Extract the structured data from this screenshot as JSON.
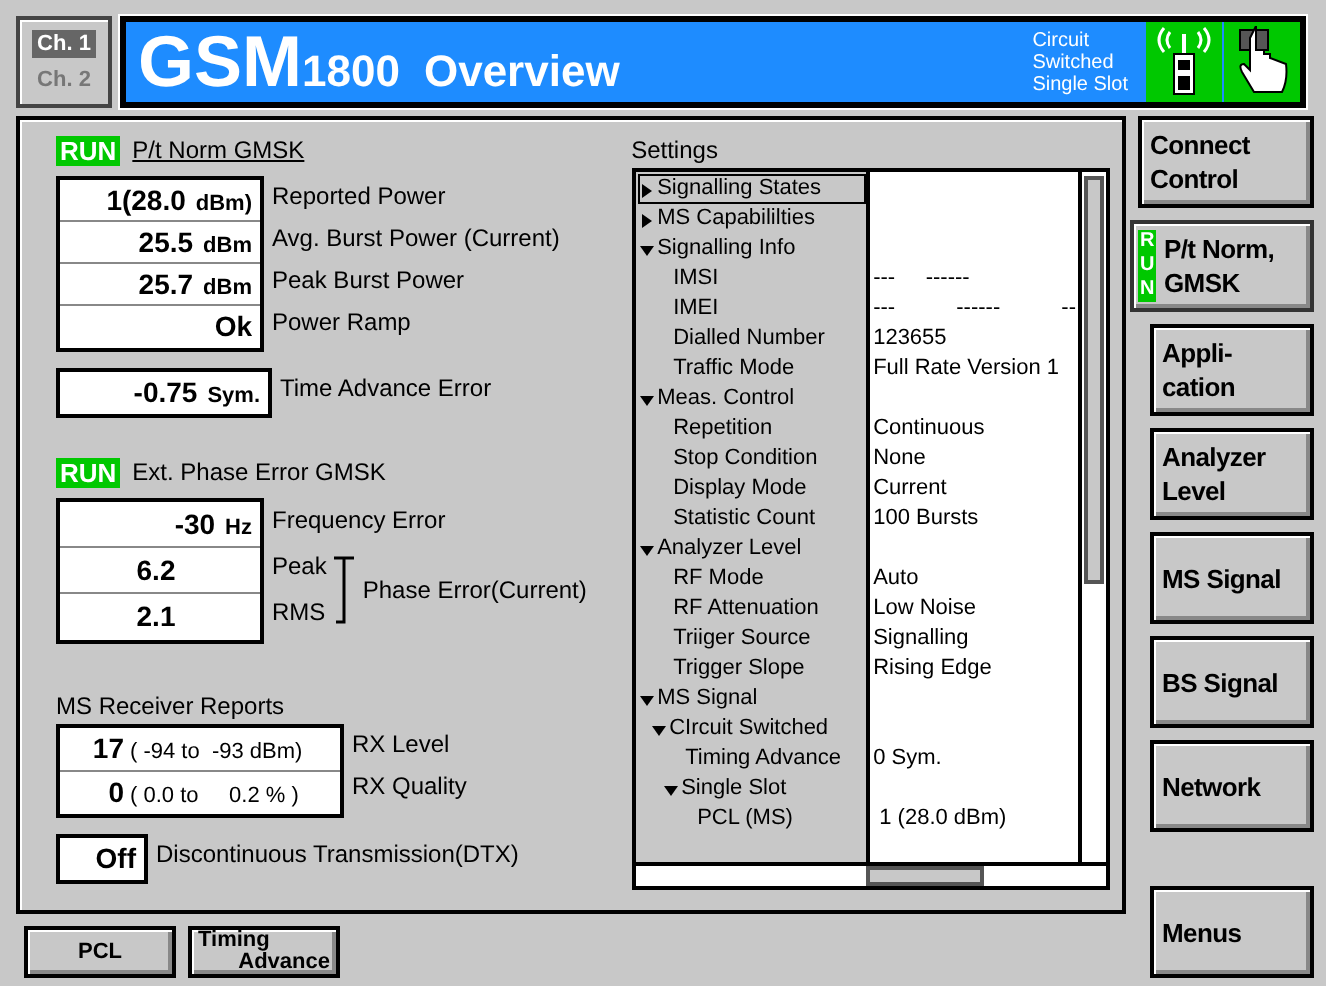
{
  "channels": [
    {
      "label": "Ch. 1",
      "selected": true
    },
    {
      "label": "Ch. 2",
      "selected": false
    }
  ],
  "title": {
    "main": "GSM",
    "band": "1800",
    "text": "Overview",
    "mode_lines": [
      "Circuit",
      "Switched",
      "Single Slot"
    ]
  },
  "connect_button": "Connect Control",
  "power": {
    "status": "RUN",
    "heading": "P/t Norm GMSK",
    "rows": [
      {
        "value": "1(28.0",
        "unit": "dBm)",
        "label": "Reported Power"
      },
      {
        "value": "25.5",
        "unit": "dBm",
        "label": "Avg. Burst Power (Current)"
      },
      {
        "value": "25.7",
        "unit": "dBm",
        "label": "Peak Burst Power"
      },
      {
        "value": "Ok",
        "unit": "",
        "label": "Power Ramp"
      }
    ],
    "timing": {
      "value": "-0.75",
      "unit": "Sym.",
      "label": "Time Advance Error"
    }
  },
  "phase": {
    "status": "RUN",
    "heading": "Ext. Phase Error GMSK",
    "frequency": {
      "value": "-30",
      "unit": "Hz",
      "label": "Frequency Error"
    },
    "peak": {
      "value": "6.2",
      "label": "Peak"
    },
    "rms": {
      "value": "2.1",
      "label": "RMS"
    },
    "group_label": "Phase Error(Current)"
  },
  "receiver": {
    "heading": "MS Receiver Reports",
    "rows": [
      {
        "value": "17",
        "range": "( -94 to  -93 dBm)",
        "label": "RX Level"
      },
      {
        "value": "0",
        "range": "( 0.0 to     0.2 % )",
        "label": "RX Quality"
      }
    ],
    "dtx": {
      "value": "Off",
      "label": "Discontinuous Transmission(DTX)"
    }
  },
  "settings": {
    "title": "Settings",
    "items": [
      {
        "label": "Signalling States",
        "expanded": false,
        "selected": true
      },
      {
        "label": "MS Capabililties",
        "expanded": false,
        "selected": false
      },
      {
        "label": "Signalling Info",
        "expanded": true,
        "selected": false,
        "children": [
          {
            "label": "IMSI",
            "value": "---     ------",
            "selected": false
          },
          {
            "label": "IMEI",
            "value": "---          ------          --",
            "selected": false
          },
          {
            "label": "Dialled Number",
            "value": "123655",
            "selected": false
          },
          {
            "label": "Traffic Mode",
            "value": "Full Rate Version 1",
            "selected": false
          }
        ]
      },
      {
        "label": "Meas. Control",
        "expanded": true,
        "selected": false,
        "children": [
          {
            "label": "Repetition",
            "value": "Continuous",
            "selected": false
          },
          {
            "label": "Stop Condition",
            "value": "None",
            "selected": false
          },
          {
            "label": "Display Mode",
            "value": "Current",
            "selected": false
          },
          {
            "label": "Statistic Count",
            "value": "100 Bursts",
            "selected": false
          }
        ]
      },
      {
        "label": "Analyzer Level",
        "expanded": true,
        "selected": false,
        "children": [
          {
            "label": "RF Mode",
            "value": "Auto",
            "selected": false
          },
          {
            "label": "RF Attenuation",
            "value": "Low Noise",
            "selected": false
          },
          {
            "label": "Triiger Source",
            "value": "Signalling",
            "selected": false
          },
          {
            "label": "Trigger Slope",
            "value": "Rising Edge",
            "selected": false
          }
        ]
      },
      {
        "label": "MS Signal",
        "expanded": true,
        "selected": false,
        "children": [
          {
            "label": "CIrcuit Switched",
            "expanded": true,
            "selected": false,
            "children": [
              {
                "label": "Timing Advance",
                "value": "0 Sym.",
                "selected": false
              },
              {
                "label": "Single Slot",
                "expanded": true,
                "selected": false,
                "children": [
                  {
                    "label": "PCL (MS)",
                    "value": " 1 (28.0 dBm)",
                    "selected": false
                  }
                ]
              }
            ]
          }
        ]
      }
    ]
  },
  "side_buttons": [
    {
      "label": "P/t Norm, GMSK",
      "status": "RUN",
      "selected": true
    },
    {
      "label": "Appli- cation",
      "selected": false
    },
    {
      "label": "Analyzer Level",
      "selected": false
    },
    {
      "label": "MS Signal",
      "selected": false
    },
    {
      "label": "BS Signal",
      "selected": false
    },
    {
      "label": "Network",
      "selected": false
    }
  ],
  "menus_button": "Menus",
  "bottom_keys": [
    {
      "lines": [
        "PCL"
      ]
    },
    {
      "lines": [
        "Timing",
        "Advance"
      ]
    }
  ]
}
